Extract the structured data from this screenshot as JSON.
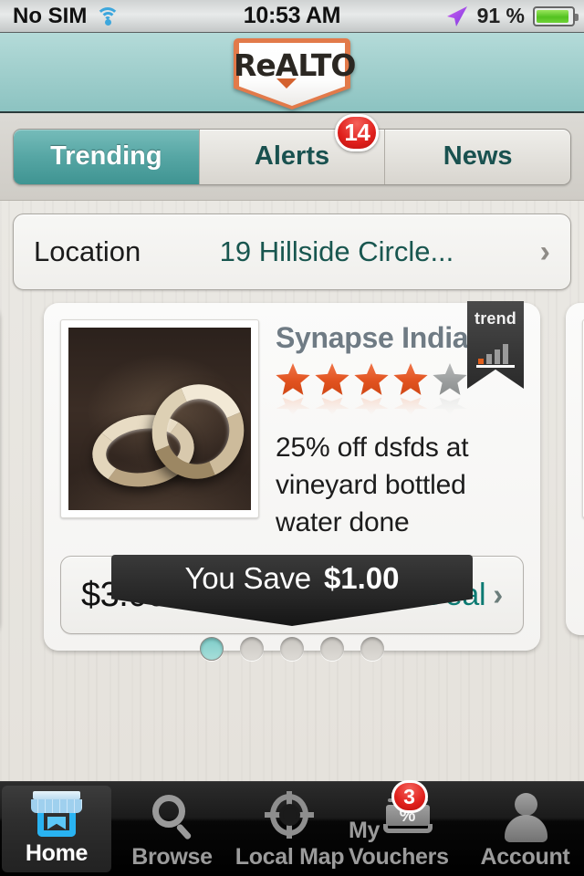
{
  "status_bar": {
    "carrier": "No SIM",
    "wifi_icon": "wifi-icon",
    "time": "10:53 AM",
    "location_arrow_icon": "location-arrow-icon",
    "battery_percent": "91 %",
    "battery_icon": "battery-icon"
  },
  "navbar": {
    "logo_text": "ReALTO",
    "logo_icon": "realto-logo-icon"
  },
  "tabs": {
    "items": [
      {
        "label": "Trending",
        "active": true,
        "badge": null
      },
      {
        "label": "Alerts",
        "active": false,
        "badge": "14"
      },
      {
        "label": "News",
        "active": false,
        "badge": null
      }
    ]
  },
  "location": {
    "label": "Location",
    "value": "19 Hillside Circle...",
    "chevron_icon": "chevron-right-icon"
  },
  "deal": {
    "merchant": "Synapse India",
    "rating": 4,
    "rating_max": 5,
    "description": "25% off dsfds at vineyard bottled water done",
    "image_alt": "wedding-rings-photo",
    "ribbon_label": "trend",
    "ribbon_icon": "bar-chart-icon",
    "price": "$3.00",
    "cta_label": "View Deal",
    "cta_chevron_icon": "chevron-right-icon",
    "save_label": "You Save",
    "save_amount": "$1.00"
  },
  "pager": {
    "total": 5,
    "active_index": 0
  },
  "bottom_nav": {
    "items": [
      {
        "label": "Home",
        "icon": "storefront-icon",
        "active": true,
        "badge": null
      },
      {
        "label": "Browse",
        "icon": "magnifier-icon",
        "active": false,
        "badge": null
      },
      {
        "label": "Local Map",
        "icon": "crosshair-icon",
        "active": false,
        "badge": null
      },
      {
        "label": "My Vouchers",
        "icon": "voucher-percent-icon",
        "active": false,
        "badge": "3"
      },
      {
        "label": "Account",
        "icon": "person-icon",
        "active": false,
        "badge": null
      }
    ]
  },
  "colors": {
    "teal_accent": "#0c7a72",
    "header_teal": "#a6d2d0",
    "star_orange": "#e1521f",
    "badge_red": "#e0201c",
    "home_blue": "#29b3f2"
  }
}
